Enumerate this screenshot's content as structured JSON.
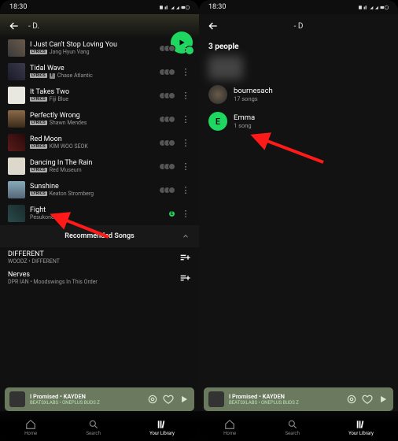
{
  "status": {
    "time": "18:30",
    "icons": "⬛ ⟳ ▮ ◢ ◢ □ ◯"
  },
  "left": {
    "header_title": "- D.",
    "tracks": [
      {
        "title": "I Just Can't Stop Loving You",
        "lyrics": true,
        "explicit": false,
        "artist": "Jang Hyun Vang",
        "avatars": 3,
        "badge": false
      },
      {
        "title": "Tidal Wave",
        "lyrics": true,
        "explicit": true,
        "artist": "Chase Atlantic",
        "avatars": 3,
        "badge": false
      },
      {
        "title": "It Takes Two",
        "lyrics": true,
        "explicit": false,
        "artist": "Fiji Blue",
        "avatars": 3,
        "badge": false
      },
      {
        "title": "Perfectly Wrong",
        "lyrics": true,
        "explicit": false,
        "artist": "Shawn Mendes",
        "avatars": 3,
        "badge": false
      },
      {
        "title": "Red Moon",
        "lyrics": true,
        "explicit": false,
        "artist": "KIM WOO SEOK",
        "avatars": 3,
        "badge": false
      },
      {
        "title": "Dancing In The Rain",
        "lyrics": true,
        "explicit": false,
        "artist": "Red Museum",
        "avatars": 3,
        "badge": false
      },
      {
        "title": "Sunshine",
        "lyrics": true,
        "explicit": false,
        "artist": "Keaton Stromberg",
        "avatars": 3,
        "badge": false
      },
      {
        "title": "Fight",
        "lyrics": false,
        "explicit": false,
        "artist": "Pesukone",
        "avatars": 0,
        "badge": true
      }
    ],
    "recommended_header": "Recommended Songs",
    "recs": [
      {
        "title": "DIFFERENT",
        "sub": "WOODZ • DIFFERENT"
      },
      {
        "title": "Nerves",
        "sub": "DPR IAN • Moodswings In This Order"
      }
    ]
  },
  "right": {
    "header_title": "- D",
    "section_title": "3 people",
    "people": [
      {
        "name": "",
        "sub": "",
        "blur": true
      },
      {
        "name": "bournesach",
        "sub": "17 songs",
        "initial": "",
        "green": false
      },
      {
        "name": "Emma",
        "sub": "1 song",
        "initial": "E",
        "green": true
      }
    ]
  },
  "now_playing": {
    "title": "I Promised • KAYDEN",
    "device": "BEATSXLABS • ONEPLUS BUDS Z"
  },
  "nav": {
    "home": "Home",
    "search": "Search",
    "library": "Your Library"
  },
  "icons": {
    "lyrics_badge": "LYRICS",
    "explicit_badge": "E"
  }
}
